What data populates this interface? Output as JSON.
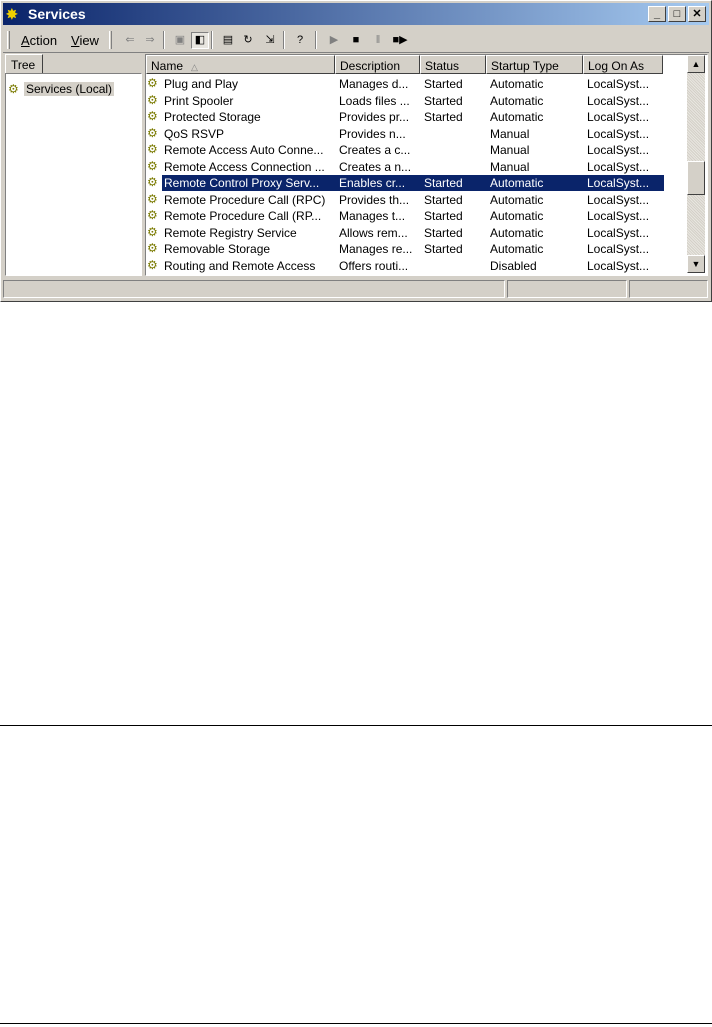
{
  "window": {
    "title": "Services"
  },
  "menu": {
    "action_prefix": "",
    "action_u": "A",
    "action_rest": "ction",
    "view_prefix": "",
    "view_u": "V",
    "view_rest": "iew"
  },
  "toolbar": {
    "buttons": [
      {
        "name": "back-arrow-icon",
        "glyph": "⇐",
        "disabled": true
      },
      {
        "name": "forward-arrow-icon",
        "glyph": "⇒",
        "disabled": true
      },
      {
        "name": "up-folder-icon",
        "glyph": "▣",
        "disabled": true
      },
      {
        "name": "show-hide-tree-icon",
        "glyph": "◧",
        "pressed": true
      },
      {
        "name": "properties-icon",
        "glyph": "▤"
      },
      {
        "name": "refresh-icon",
        "glyph": "↻"
      },
      {
        "name": "export-list-icon",
        "glyph": "⇲"
      },
      {
        "name": "help-icon",
        "glyph": "?"
      },
      {
        "name": "start-service-icon",
        "glyph": "▶",
        "disabled": true
      },
      {
        "name": "stop-service-icon",
        "glyph": "■"
      },
      {
        "name": "pause-service-icon",
        "glyph": "‖",
        "disabled": true
      },
      {
        "name": "restart-service-icon",
        "glyph": "■▶"
      }
    ]
  },
  "tree": {
    "tab_label": "Tree",
    "root_label": "Services (Local)"
  },
  "columns": {
    "name": "Name",
    "description": "Description",
    "status": "Status",
    "startup_type": "Startup Type",
    "log_on_as": "Log On As"
  },
  "services": [
    {
      "name": "Plug and Play",
      "description": "Manages d...",
      "status": "Started",
      "startup": "Automatic",
      "logon": "LocalSyst..."
    },
    {
      "name": "Print Spooler",
      "description": "Loads files ...",
      "status": "Started",
      "startup": "Automatic",
      "logon": "LocalSyst..."
    },
    {
      "name": "Protected Storage",
      "description": "Provides pr...",
      "status": "Started",
      "startup": "Automatic",
      "logon": "LocalSyst..."
    },
    {
      "name": "QoS RSVP",
      "description": "Provides n...",
      "status": "",
      "startup": "Manual",
      "logon": "LocalSyst..."
    },
    {
      "name": "Remote Access Auto Conne...",
      "description": "Creates a c...",
      "status": "",
      "startup": "Manual",
      "logon": "LocalSyst..."
    },
    {
      "name": "Remote Access Connection ...",
      "description": "Creates a n...",
      "status": "",
      "startup": "Manual",
      "logon": "LocalSyst..."
    },
    {
      "name": "Remote Control Proxy Serv...",
      "description": "Enables cr...",
      "status": "Started",
      "startup": "Automatic",
      "logon": "LocalSyst...",
      "selected": true
    },
    {
      "name": "Remote Procedure Call (RPC)",
      "description": "Provides th...",
      "status": "Started",
      "startup": "Automatic",
      "logon": "LocalSyst..."
    },
    {
      "name": "Remote Procedure Call (RP...",
      "description": "Manages t...",
      "status": "Started",
      "startup": "Automatic",
      "logon": "LocalSyst..."
    },
    {
      "name": "Remote Registry Service",
      "description": "Allows rem...",
      "status": "Started",
      "startup": "Automatic",
      "logon": "LocalSyst..."
    },
    {
      "name": "Removable Storage",
      "description": "Manages re...",
      "status": "Started",
      "startup": "Automatic",
      "logon": "LocalSyst..."
    },
    {
      "name": "Routing and Remote Access",
      "description": "Offers routi...",
      "status": "",
      "startup": "Disabled",
      "logon": "LocalSyst..."
    }
  ]
}
